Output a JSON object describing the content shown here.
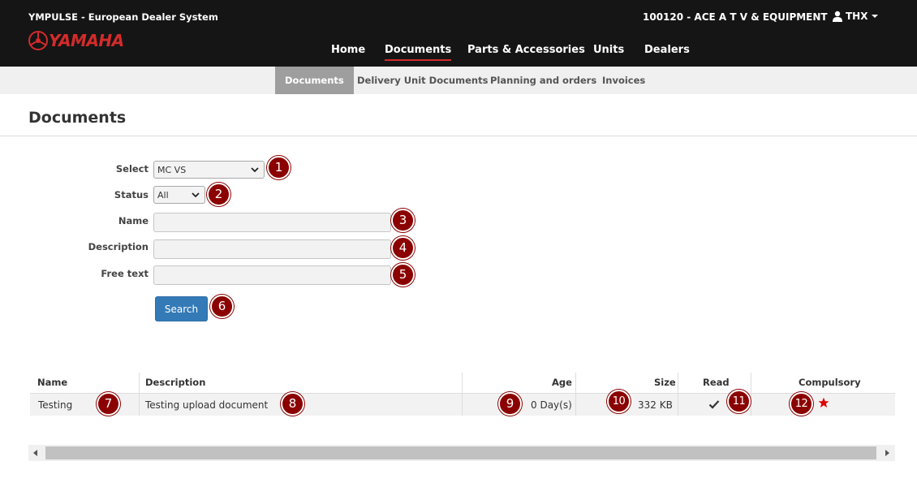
{
  "header": {
    "app_title": "YMPULSE - European Dealer System",
    "logo_text": "YAMAHA",
    "dealer": "100120 - ACE A T V & EQUIPMENT",
    "user": "THX",
    "nav": [
      {
        "label": "Home",
        "active": false
      },
      {
        "label": "Documents",
        "active": true
      },
      {
        "label": "Parts & Accessories",
        "active": false
      },
      {
        "label": "Units",
        "active": false
      },
      {
        "label": "Dealers",
        "active": false
      }
    ]
  },
  "subnav": [
    {
      "label": "Documents",
      "active": true
    },
    {
      "label": "Delivery Unit Documents",
      "active": false
    },
    {
      "label": "Planning and orders",
      "active": false
    },
    {
      "label": "Invoices",
      "active": false
    }
  ],
  "page_title": "Documents",
  "form": {
    "select_label": "Select",
    "select_value": "MC VS",
    "status_label": "Status",
    "status_value": "All",
    "name_label": "Name",
    "name_value": "",
    "description_label": "Description",
    "description_value": "",
    "freetext_label": "Free text",
    "freetext_value": "",
    "search_button": "Search"
  },
  "badges": [
    "1",
    "2",
    "3",
    "4",
    "5",
    "6",
    "7",
    "8",
    "9",
    "10",
    "11",
    "12"
  ],
  "table": {
    "headers": {
      "name": "Name",
      "description": "Description",
      "age": "Age",
      "size": "Size",
      "read": "Read",
      "compulsory": "Compulsory"
    },
    "rows": [
      {
        "name": "Testing",
        "description": "Testing upload document",
        "age": "0 Day(s)",
        "size": "332 KB",
        "read": true,
        "compulsory": true
      }
    ]
  },
  "colors": {
    "header_bg": "#151515",
    "brand_red": "#d42b2b",
    "badge": "#8b0000",
    "button": "#337ab7"
  },
  "icons": [
    "yamaha-logo-icon",
    "user-icon",
    "chevron-down-icon",
    "checkmark-icon",
    "star-icon",
    "scroll-left-icon",
    "scroll-right-icon"
  ]
}
